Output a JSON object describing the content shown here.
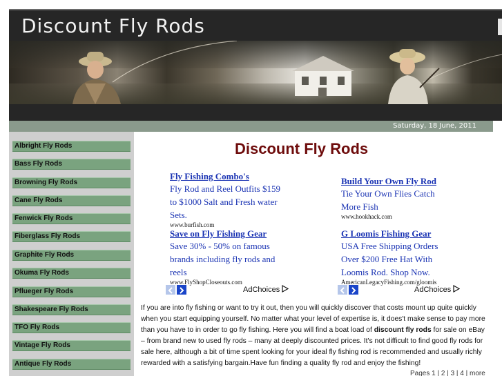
{
  "header": {
    "site_title": "Discount Fly Rods"
  },
  "datebar": {
    "date": "Saturday, 18 June, 2011"
  },
  "sidebar": {
    "items": [
      {
        "label": "Albright Fly Rods"
      },
      {
        "label": "Bass Fly Rods"
      },
      {
        "label": "Browning Fly Rods"
      },
      {
        "label": "Cane Fly Rods"
      },
      {
        "label": "Fenwick Fly Rods"
      },
      {
        "label": "Fiberglass Fly Rods"
      },
      {
        "label": "Graphite Fly Rods"
      },
      {
        "label": "Okuma Fly Rods"
      },
      {
        "label": "Pflueger Fly Rods"
      },
      {
        "label": "Shakespeare Fly Rods"
      },
      {
        "label": "TFO Fly Rods"
      },
      {
        "label": "Vintage Fly Rods"
      },
      {
        "label": "Antique Fly Rods"
      }
    ]
  },
  "main": {
    "title": "Discount Fly Rods",
    "ads": [
      {
        "title": "Fly Fishing Combo's",
        "body": "Fly Rod and Reel Outfits $159 to $1000 Salt and Fresh water Sets.",
        "url": "www.burfish.com"
      },
      {
        "title": "Build Your Own Fly Rod",
        "body": "Tie Your Own Flies Catch More Fish",
        "url": "www.hookhack.com"
      },
      {
        "title": "Save on Fly Fishing Gear",
        "body": "Save 30% - 50% on famous brands including fly rods and reels",
        "url": "www.FlyShopCloseouts.com"
      },
      {
        "title": "G Loomis Fishing Gear",
        "body": "USA Free Shipping Orders Over $200 Free Hat With Loomis Rod. Shop Now.",
        "url": "AmericanLegacyFishing.com/gloomis"
      }
    ],
    "adchoices_label": "AdChoices",
    "body_before": "If you are into fly fishing or want to try it out, then you will quickly discover that costs mount up quite quickly when you start equipping yourself. No matter what your level of expertise is, it does't make sense to pay more than you have to in order to go fly fishing. Here you will find a boat load of ",
    "body_bold": "discount fly rods",
    "body_after": " for sale on eBay – from brand new to used fly rods – many at deeply discounted prices. It's not difficult to find good fly rods for sale here, although a bit of time spent looking for your ideal fly fishing rod is recommended and usually richly rewarded with a satisfying bargain.Have fun finding a quality fly rod and enjoy the fishing!",
    "pagination": {
      "label": "Pages",
      "pages": [
        "1",
        "2",
        "3",
        "4"
      ],
      "more": "more"
    }
  },
  "colors": {
    "header_bg": "#262626",
    "nav_item_bg": "#7aa37f",
    "title_red": "#6e0c0c",
    "ad_link_blue": "#1a33b3"
  }
}
